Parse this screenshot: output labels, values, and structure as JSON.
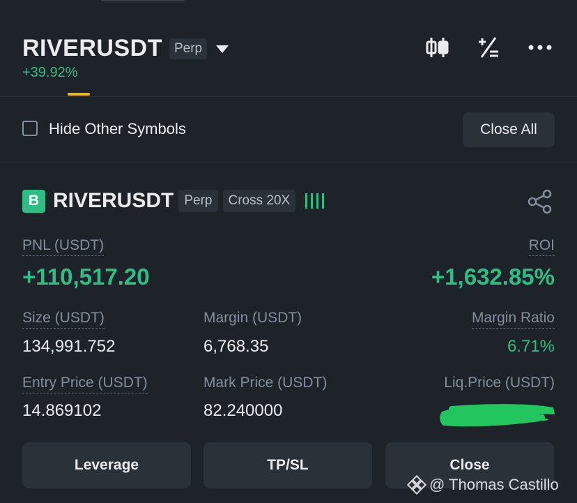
{
  "header": {
    "symbol": "RIVERUSDT",
    "contract_type": "Perp",
    "change": "+39.92%",
    "icons": [
      "candlestick-chart-icon",
      "calculator-icon",
      "more-icon"
    ]
  },
  "filter": {
    "hide_other_symbols_label": "Hide Other Symbols",
    "hide_other_symbols_checked": false,
    "close_all_label": "Close All"
  },
  "position": {
    "side_badge": "B",
    "symbol": "RIVERUSDT",
    "contract_type": "Perp",
    "margin_mode": "Cross 20X",
    "pnl_label": "PNL (USDT)",
    "pnl_value": "+110,517.20",
    "roi_label": "ROI",
    "roi_value": "+1,632.85%",
    "size_label": "Size (USDT)",
    "size_value": "134,991.752",
    "margin_label": "Margin (USDT)",
    "margin_value": "6,768.35",
    "margin_ratio_label": "Margin Ratio",
    "margin_ratio_value": "6.71%",
    "entry_price_label": "Entry Price (USDT)",
    "entry_price_value": "14.869102",
    "mark_price_label": "Mark Price (USDT)",
    "mark_price_value": "82.240000",
    "liq_price_label": "Liq.Price (USDT)"
  },
  "actions": {
    "leverage_label": "Leverage",
    "tpsl_label": "TP/SL",
    "close_label": "Close"
  },
  "watermark": {
    "text": "@ Thomas Castillo"
  },
  "colors": {
    "background": "#1e2329",
    "surface": "#2b3139",
    "positive": "#2ebd85",
    "accent": "#f0b90b",
    "text": "#eaecef",
    "muted": "#848e9c",
    "redaction": "#22c55e"
  }
}
